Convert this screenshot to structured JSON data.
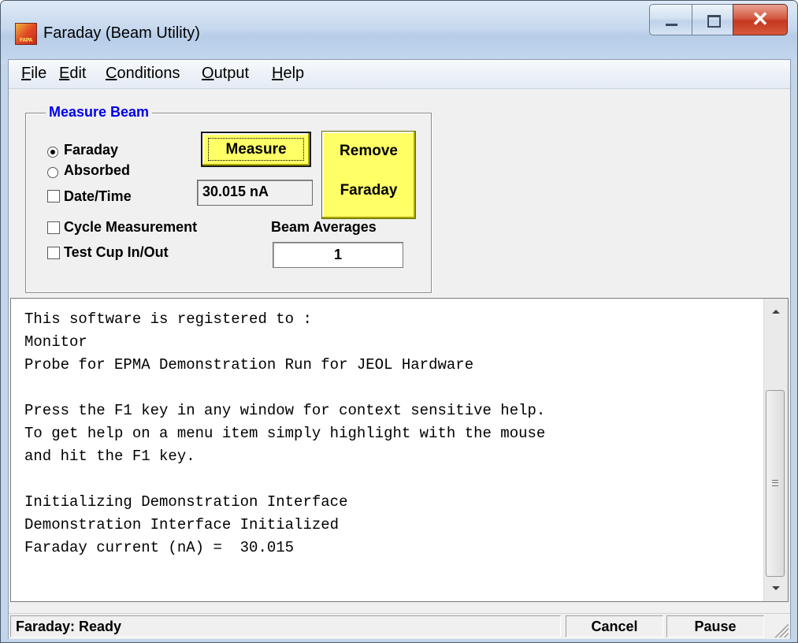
{
  "window": {
    "title": "Faraday (Beam Utility)",
    "icon": "app-logo-icon",
    "icon_text": "FAPA",
    "controls": {
      "minimize": "minimize-icon",
      "maximize": "maximize-icon",
      "close": "✕"
    }
  },
  "menu": {
    "items": [
      "File",
      "Edit",
      "Conditions",
      "Output",
      "Help"
    ]
  },
  "measure_group": {
    "legend": "Measure Beam",
    "radio_faraday": {
      "label": "Faraday",
      "selected": true
    },
    "radio_absorbed": {
      "label": "Absorbed",
      "selected": false
    },
    "check_datetime": {
      "label": "Date/Time",
      "checked": false
    },
    "check_cycle": {
      "label": "Cycle Measurement",
      "checked": false
    },
    "check_testcup": {
      "label": "Test Cup In/Out",
      "checked": false
    },
    "measure_button": "Measure",
    "remove_button": {
      "line1": "Remove",
      "line2": "Faraday"
    },
    "current_readout": "30.015 nA",
    "beam_averages_label": "Beam Averages",
    "beam_averages_value": "1",
    "button_color": "#ffff66"
  },
  "log": {
    "lines": [
      "This software is registered to :",
      "Monitor",
      "Probe for EPMA Demonstration Run for JEOL Hardware",
      "",
      "Press the F1 key in any window for context sensitive help.",
      "To get help on a menu item simply highlight with the mouse",
      "and hit the F1 key.",
      "",
      "Initializing Demonstration Interface",
      "Demonstration Interface Initialized",
      "Faraday current (nA) =  30.015"
    ]
  },
  "status": {
    "text": "Faraday: Ready",
    "cancel": "Cancel",
    "pause": "Pause"
  }
}
